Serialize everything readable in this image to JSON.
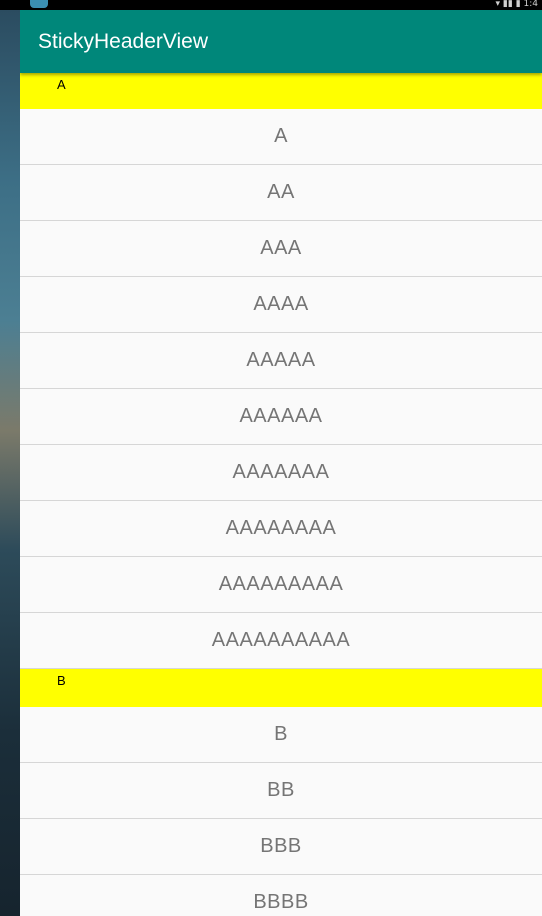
{
  "status_bar": {
    "right_text": "▾ ▮▮ ▮ 1:4"
  },
  "app_bar": {
    "title": "StickyHeaderView"
  },
  "sections": [
    {
      "header": "A",
      "items": [
        "A",
        "AA",
        "AAA",
        "AAAA",
        "AAAAA",
        "AAAAAA",
        "AAAAAAA",
        "AAAAAAAA",
        "AAAAAAAAA",
        "AAAAAAAAAA"
      ]
    },
    {
      "header": "B",
      "items": [
        "B",
        "BB",
        "BBB",
        "BBBB"
      ]
    }
  ],
  "colors": {
    "app_bar": "#00877a",
    "section_header": "#ffff00",
    "list_background": "#fafafa",
    "item_text": "#757575"
  }
}
